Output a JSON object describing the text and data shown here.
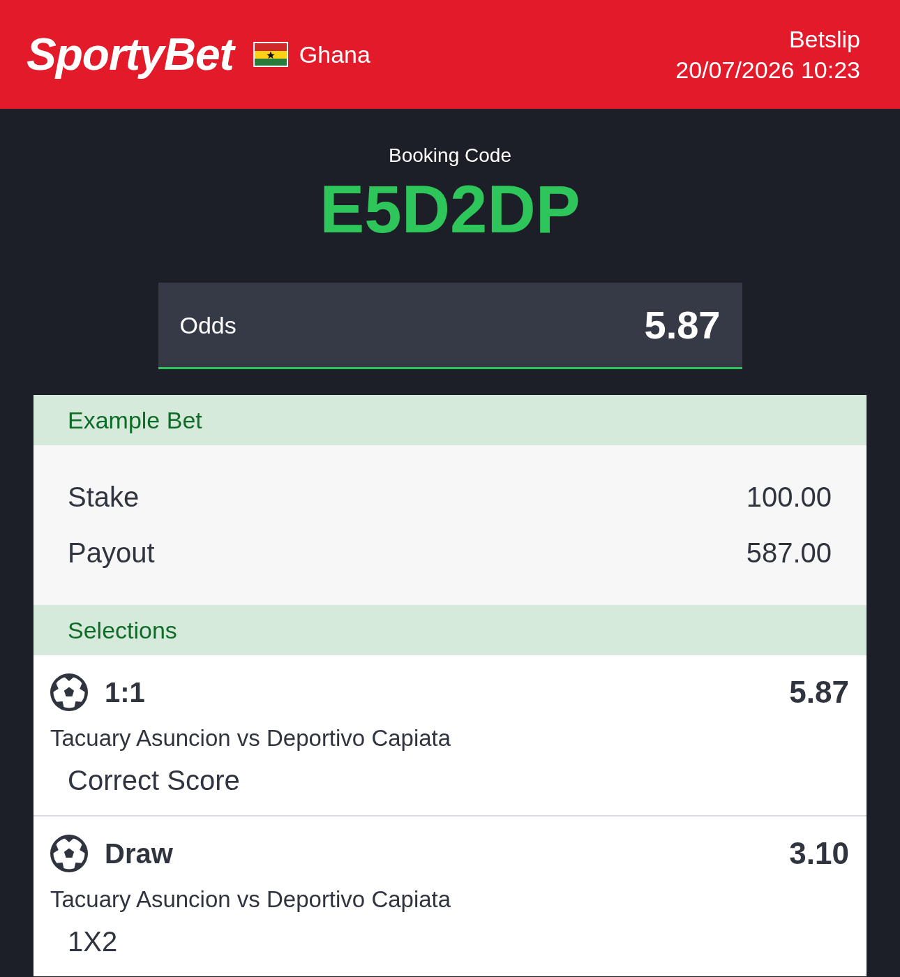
{
  "header": {
    "logo": "SportyBet",
    "country": "Ghana",
    "title": "Betslip",
    "datetime": "20/07/2026 10:23"
  },
  "booking": {
    "label": "Booking Code",
    "code": "E5D2DP"
  },
  "odds": {
    "label": "Odds",
    "value": "5.87"
  },
  "example_bet": {
    "title": "Example Bet",
    "rows": [
      {
        "label": "Stake",
        "value": "100.00"
      },
      {
        "label": "Payout",
        "value": "587.00"
      }
    ]
  },
  "selections": {
    "title": "Selections",
    "items": [
      {
        "kind": "football",
        "pick": "1:1",
        "odds": "5.87",
        "match": "Tacuary Asuncion vs Deportivo Capiata",
        "market": "Correct Score"
      },
      {
        "kind": "football",
        "pick": "Draw",
        "odds": "3.10",
        "match": "Tacuary Asuncion vs Deportivo Capiata",
        "market": "1X2"
      }
    ]
  }
}
